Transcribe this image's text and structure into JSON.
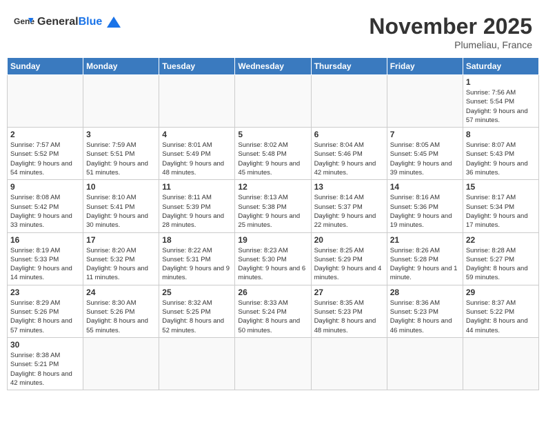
{
  "header": {
    "logo_general": "General",
    "logo_blue": "Blue",
    "month_title": "November 2025",
    "location": "Plumeliau, France"
  },
  "days_of_week": [
    "Sunday",
    "Monday",
    "Tuesday",
    "Wednesday",
    "Thursday",
    "Friday",
    "Saturday"
  ],
  "weeks": [
    [
      {
        "day": "",
        "info": ""
      },
      {
        "day": "",
        "info": ""
      },
      {
        "day": "",
        "info": ""
      },
      {
        "day": "",
        "info": ""
      },
      {
        "day": "",
        "info": ""
      },
      {
        "day": "",
        "info": ""
      },
      {
        "day": "1",
        "info": "Sunrise: 7:56 AM\nSunset: 5:54 PM\nDaylight: 9 hours and 57 minutes."
      }
    ],
    [
      {
        "day": "2",
        "info": "Sunrise: 7:57 AM\nSunset: 5:52 PM\nDaylight: 9 hours and 54 minutes."
      },
      {
        "day": "3",
        "info": "Sunrise: 7:59 AM\nSunset: 5:51 PM\nDaylight: 9 hours and 51 minutes."
      },
      {
        "day": "4",
        "info": "Sunrise: 8:01 AM\nSunset: 5:49 PM\nDaylight: 9 hours and 48 minutes."
      },
      {
        "day": "5",
        "info": "Sunrise: 8:02 AM\nSunset: 5:48 PM\nDaylight: 9 hours and 45 minutes."
      },
      {
        "day": "6",
        "info": "Sunrise: 8:04 AM\nSunset: 5:46 PM\nDaylight: 9 hours and 42 minutes."
      },
      {
        "day": "7",
        "info": "Sunrise: 8:05 AM\nSunset: 5:45 PM\nDaylight: 9 hours and 39 minutes."
      },
      {
        "day": "8",
        "info": "Sunrise: 8:07 AM\nSunset: 5:43 PM\nDaylight: 9 hours and 36 minutes."
      }
    ],
    [
      {
        "day": "9",
        "info": "Sunrise: 8:08 AM\nSunset: 5:42 PM\nDaylight: 9 hours and 33 minutes."
      },
      {
        "day": "10",
        "info": "Sunrise: 8:10 AM\nSunset: 5:41 PM\nDaylight: 9 hours and 30 minutes."
      },
      {
        "day": "11",
        "info": "Sunrise: 8:11 AM\nSunset: 5:39 PM\nDaylight: 9 hours and 28 minutes."
      },
      {
        "day": "12",
        "info": "Sunrise: 8:13 AM\nSunset: 5:38 PM\nDaylight: 9 hours and 25 minutes."
      },
      {
        "day": "13",
        "info": "Sunrise: 8:14 AM\nSunset: 5:37 PM\nDaylight: 9 hours and 22 minutes."
      },
      {
        "day": "14",
        "info": "Sunrise: 8:16 AM\nSunset: 5:36 PM\nDaylight: 9 hours and 19 minutes."
      },
      {
        "day": "15",
        "info": "Sunrise: 8:17 AM\nSunset: 5:34 PM\nDaylight: 9 hours and 17 minutes."
      }
    ],
    [
      {
        "day": "16",
        "info": "Sunrise: 8:19 AM\nSunset: 5:33 PM\nDaylight: 9 hours and 14 minutes."
      },
      {
        "day": "17",
        "info": "Sunrise: 8:20 AM\nSunset: 5:32 PM\nDaylight: 9 hours and 11 minutes."
      },
      {
        "day": "18",
        "info": "Sunrise: 8:22 AM\nSunset: 5:31 PM\nDaylight: 9 hours and 9 minutes."
      },
      {
        "day": "19",
        "info": "Sunrise: 8:23 AM\nSunset: 5:30 PM\nDaylight: 9 hours and 6 minutes."
      },
      {
        "day": "20",
        "info": "Sunrise: 8:25 AM\nSunset: 5:29 PM\nDaylight: 9 hours and 4 minutes."
      },
      {
        "day": "21",
        "info": "Sunrise: 8:26 AM\nSunset: 5:28 PM\nDaylight: 9 hours and 1 minute."
      },
      {
        "day": "22",
        "info": "Sunrise: 8:28 AM\nSunset: 5:27 PM\nDaylight: 8 hours and 59 minutes."
      }
    ],
    [
      {
        "day": "23",
        "info": "Sunrise: 8:29 AM\nSunset: 5:26 PM\nDaylight: 8 hours and 57 minutes."
      },
      {
        "day": "24",
        "info": "Sunrise: 8:30 AM\nSunset: 5:26 PM\nDaylight: 8 hours and 55 minutes."
      },
      {
        "day": "25",
        "info": "Sunrise: 8:32 AM\nSunset: 5:25 PM\nDaylight: 8 hours and 52 minutes."
      },
      {
        "day": "26",
        "info": "Sunrise: 8:33 AM\nSunset: 5:24 PM\nDaylight: 8 hours and 50 minutes."
      },
      {
        "day": "27",
        "info": "Sunrise: 8:35 AM\nSunset: 5:23 PM\nDaylight: 8 hours and 48 minutes."
      },
      {
        "day": "28",
        "info": "Sunrise: 8:36 AM\nSunset: 5:23 PM\nDaylight: 8 hours and 46 minutes."
      },
      {
        "day": "29",
        "info": "Sunrise: 8:37 AM\nSunset: 5:22 PM\nDaylight: 8 hours and 44 minutes."
      }
    ],
    [
      {
        "day": "30",
        "info": "Sunrise: 8:38 AM\nSunset: 5:21 PM\nDaylight: 8 hours and 42 minutes."
      },
      {
        "day": "",
        "info": ""
      },
      {
        "day": "",
        "info": ""
      },
      {
        "day": "",
        "info": ""
      },
      {
        "day": "",
        "info": ""
      },
      {
        "day": "",
        "info": ""
      },
      {
        "day": "",
        "info": ""
      }
    ]
  ]
}
